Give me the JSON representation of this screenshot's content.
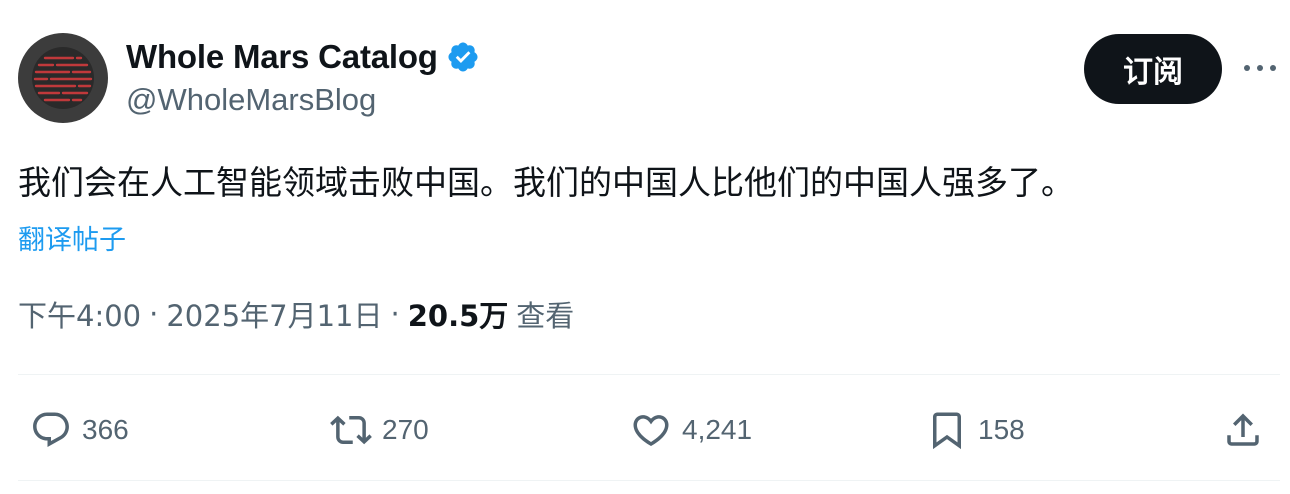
{
  "author": {
    "display_name": "Whole Mars Catalog",
    "handle": "@WholeMarsBlog",
    "verified": true
  },
  "subscribe_label": "订阅",
  "tweet_text": "我们会在人工智能领域击败中国。我们的中国人比他们的中国人强多了。",
  "translate_label": "翻译帖子",
  "meta": {
    "time": "下午4:00",
    "separator": "·",
    "date": "2025年7月11日",
    "views_count": "20.5万",
    "views_label": "查看"
  },
  "actions": {
    "reply_count": "366",
    "retweet_count": "270",
    "like_count": "4,241",
    "bookmark_count": "158"
  },
  "colors": {
    "text": "#0f1419",
    "secondary": "#536471",
    "link": "#1d9bf0",
    "verified": "#1d9bf0",
    "button_bg": "#0f1419"
  },
  "icons": [
    "reply-icon",
    "retweet-icon",
    "like-icon",
    "bookmark-icon",
    "share-icon",
    "verified-badge-icon",
    "more-icon"
  ]
}
